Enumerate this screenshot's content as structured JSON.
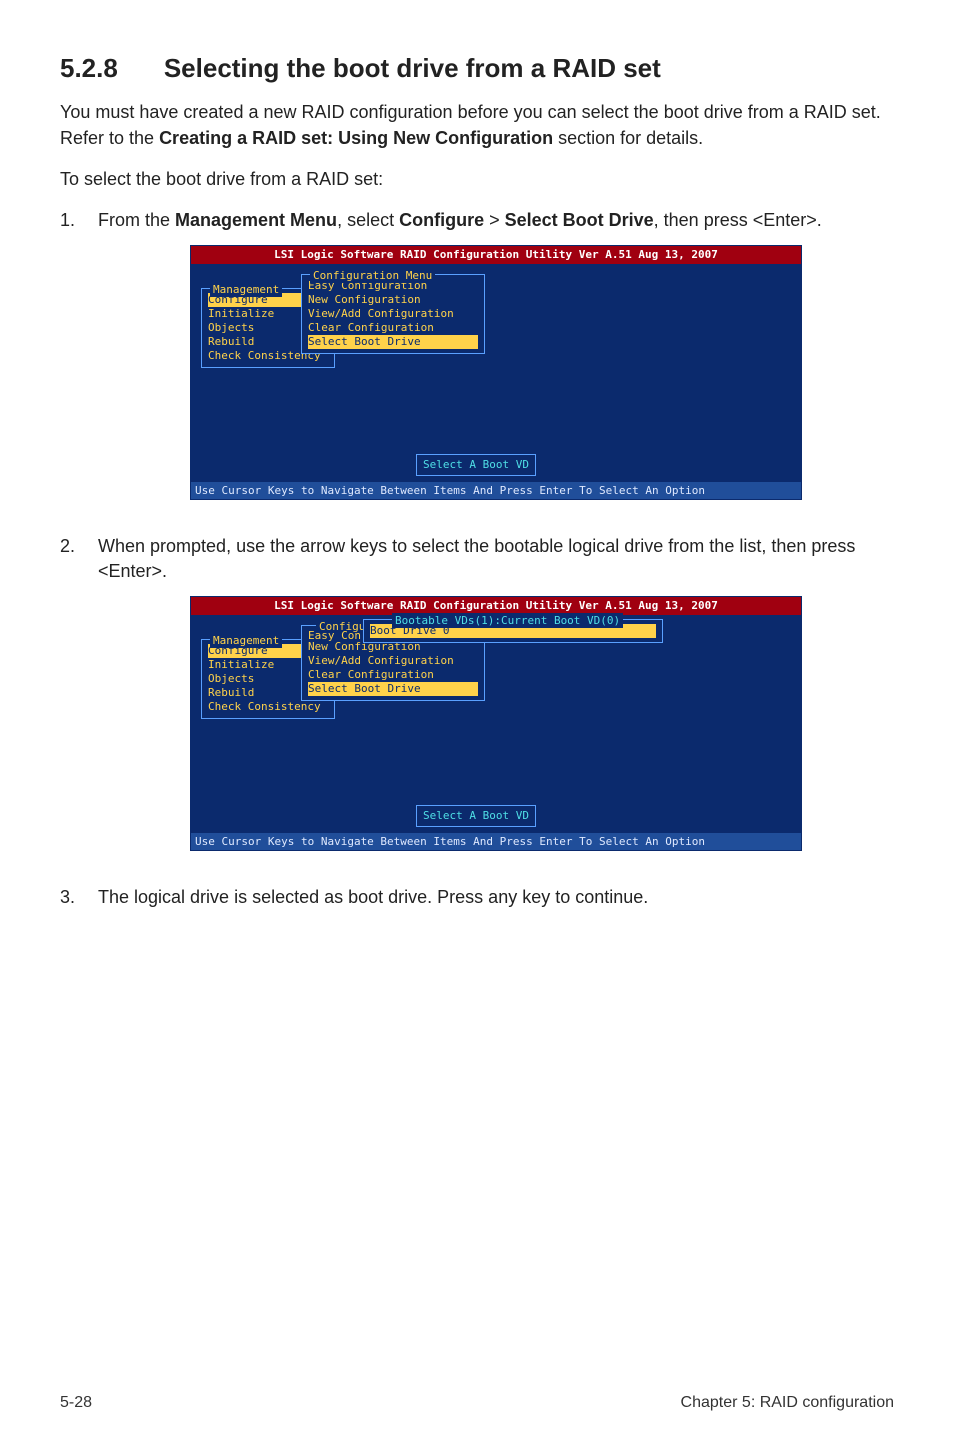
{
  "heading": {
    "number": "5.2.8",
    "title": "Selecting the boot drive from a RAID set"
  },
  "intro": {
    "p1_pre": "You must have created a new RAID configuration before you can select the boot drive from a RAID set. Refer to the ",
    "p1_bold": "Creating a RAID set: Using New Configuration",
    "p1_post": " section for details.",
    "p2": "To select the boot drive from a RAID set:"
  },
  "steps": {
    "s1": {
      "num": "1.",
      "pre": "From the ",
      "b1": "Management Menu",
      "mid1": ", select ",
      "b2": "Configure",
      "mid2": " > ",
      "b3": "Select Boot Drive",
      "post": ", then press <Enter>."
    },
    "s2": {
      "num": "2.",
      "text": "When prompted, use the arrow keys to select the bootable logical drive from the list, then press <Enter>."
    },
    "s3": {
      "num": "3.",
      "text": "The logical drive is selected as boot drive. Press any key to continue."
    }
  },
  "terminal": {
    "title": "LSI Logic Software RAID Configuration Utility Ver A.51 Aug 13, 2007",
    "footer": "Use Cursor Keys to Navigate Between Items And Press Enter To Select An Option",
    "mgmt_title": "Management",
    "mgmt_items": {
      "i0": "Configure",
      "i1": "Initialize",
      "i2": "Objects",
      "i3": "Rebuild",
      "i4": "Check Consistency"
    },
    "cfg_title": "Configuration Menu",
    "cfg_items": {
      "i0": "Easy Configuration",
      "i1": "New Configuration",
      "i2": "View/Add Configuration",
      "i3": "Clear Configuration",
      "i4": "Select Boot Drive"
    },
    "hint": "Select A Boot VD",
    "cfg_trunc_title": "Configu",
    "easy_trunc": "Easy Con",
    "boot_panel_title": "Bootable VDs(1):Current Boot VD(0)",
    "boot_item": "Boot Drive 0"
  },
  "footer": {
    "left": "5-28",
    "right": "Chapter 5: RAID configuration"
  }
}
